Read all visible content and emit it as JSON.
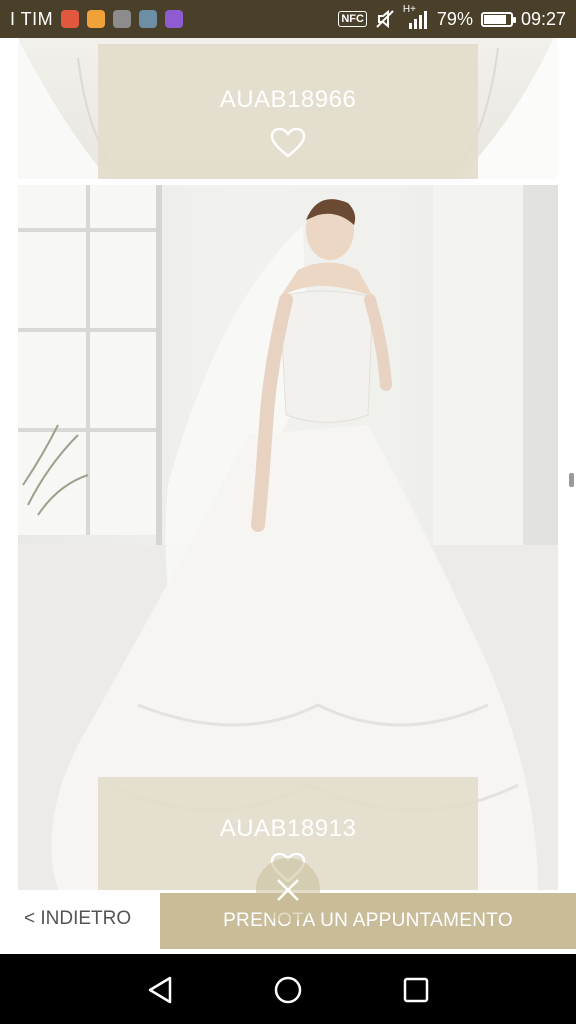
{
  "status_bar": {
    "carrier": "I TIM",
    "nfc_label": "NFC",
    "network_label": "H+",
    "battery_percent": "79%",
    "battery_level": 0.79,
    "time": "09:27",
    "notification_icons": [
      "app-icon-red",
      "app-icon-orange",
      "gallery-icon",
      "image-icon",
      "video-icon"
    ],
    "colors": {
      "background": "#4a3f28"
    }
  },
  "products": [
    {
      "code": "AUAB18966",
      "favorite_icon": "heart-outline-icon"
    },
    {
      "code": "AUAB18913",
      "favorite_icon": "heart-outline-icon"
    }
  ],
  "actions": {
    "back_label": "< INDIETRO",
    "book_label": "PRENOTA UN APPUNTAMENTO",
    "fab_icon": "close-icon"
  },
  "nav_bar": {
    "icons": [
      "back-triangle-icon",
      "home-circle-icon",
      "recents-square-icon"
    ]
  },
  "colors": {
    "accent": "#c9bd99",
    "label_background": "#e2dccb"
  }
}
